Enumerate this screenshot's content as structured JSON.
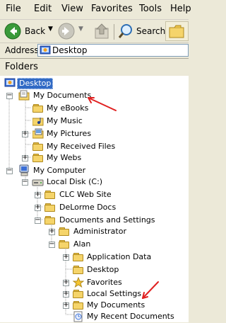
{
  "menu": [
    "File",
    "Edit",
    "View",
    "Favorites",
    "Tools",
    "Help"
  ],
  "toolbar": {
    "back_label": "Back",
    "search_label": "Search"
  },
  "address": {
    "label": "Address",
    "value": "Desktop"
  },
  "folders_pane": {
    "title": "Folders"
  },
  "tree": [
    {
      "label": "Desktop",
      "selected": true
    },
    {
      "label": "My Documents"
    },
    {
      "label": "My eBooks"
    },
    {
      "label": "My Music"
    },
    {
      "label": "My Pictures"
    },
    {
      "label": "My Received Files"
    },
    {
      "label": "My Webs"
    },
    {
      "label": "My Computer"
    },
    {
      "label": "Local Disk (C:)"
    },
    {
      "label": "CLC Web Site"
    },
    {
      "label": "DeLorme Docs"
    },
    {
      "label": "Documents and Settings"
    },
    {
      "label": "Administrator"
    },
    {
      "label": "Alan"
    },
    {
      "label": "Application Data"
    },
    {
      "label": "Desktop"
    },
    {
      "label": "Favorites"
    },
    {
      "label": "Local Settings"
    },
    {
      "label": "My Documents"
    },
    {
      "label": "My Recent Documents"
    }
  ],
  "colors": {
    "chrome": "#ece9d8",
    "selection": "#316ac5",
    "annotation_arrow": "#e02020"
  }
}
